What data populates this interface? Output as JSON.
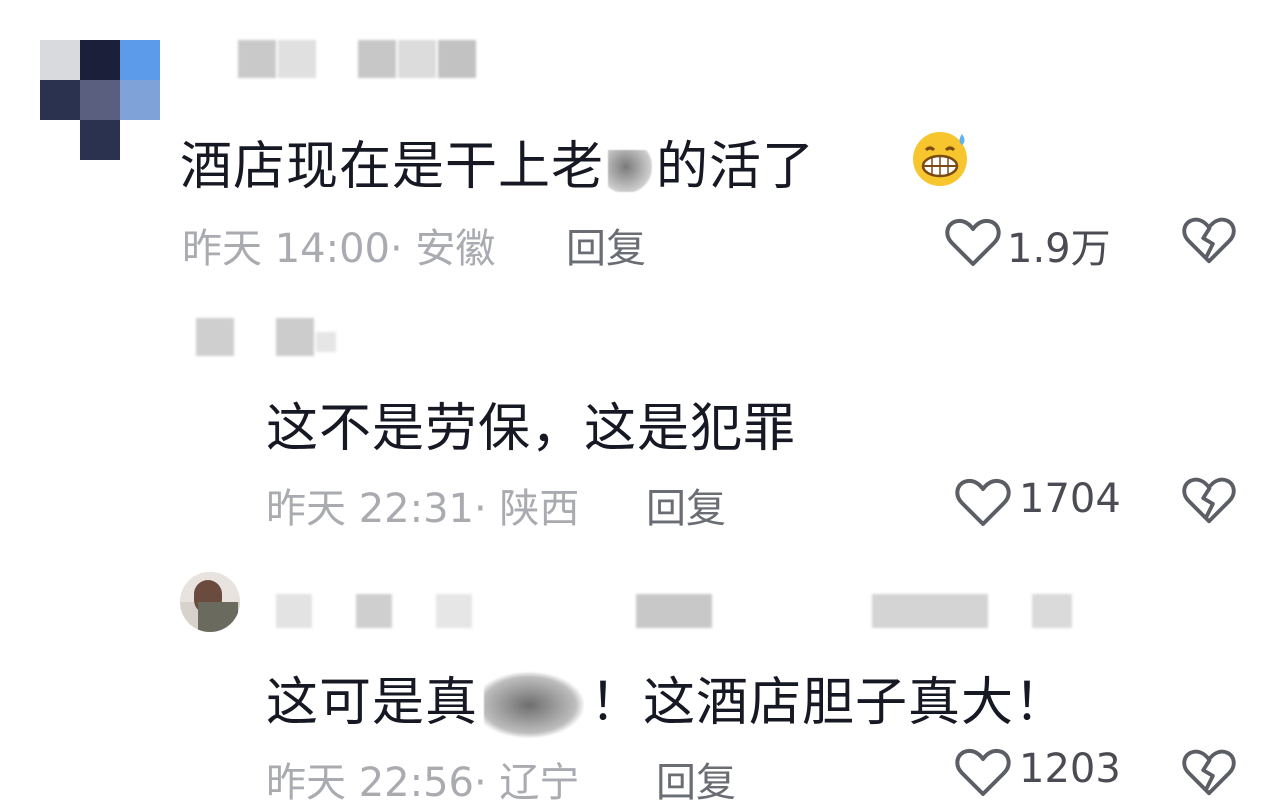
{
  "comments": [
    {
      "id": "top",
      "text": "酒店现在是干上老",
      "text_tail": "的活了",
      "emoji": "grinning-sweat-emoji",
      "time": "昨天 14:00",
      "location": "· 安徽",
      "reply_label": "回复",
      "likes": "1.9万"
    },
    {
      "id": "reply-1",
      "text": "这不是劳保，这是犯罪",
      "time": "昨天 22:31",
      "location": "· 陕西",
      "reply_label": "回复",
      "likes": "1704"
    },
    {
      "id": "reply-2",
      "text": "这可是真",
      "text_tail": "！这酒店胆子真大！",
      "time": "昨天 22:56",
      "location": "· 辽宁",
      "reply_label": "回复",
      "likes": "1203"
    }
  ],
  "colors": {
    "primary_text": "#161823",
    "meta_text": "#a9abb1",
    "reply_text": "#6b6d75",
    "icon_stroke": "#5c5e66"
  }
}
